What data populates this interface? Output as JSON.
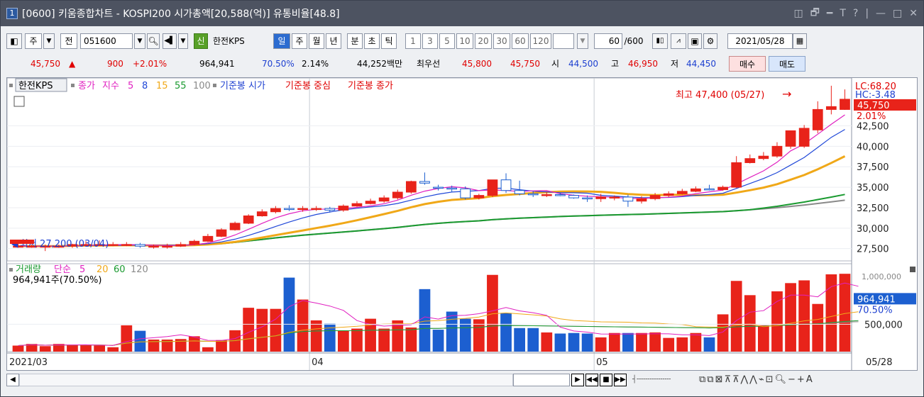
{
  "window": {
    "number": "1",
    "title": "[0600] 키움종합차트 - KOSPI200 시가총액[20,588(억)] 유통비율[48.8]",
    "buttons": [
      "◫",
      "🗗",
      "━",
      "T",
      "?",
      "|",
      "—",
      "□",
      "✕"
    ]
  },
  "toolbar": {
    "type": "주",
    "prefix": "전",
    "code": "051600",
    "name": "한전KPS",
    "new_badge": "신",
    "periods": [
      "일",
      "주",
      "월",
      "년",
      "분",
      "초",
      "틱"
    ],
    "intervals": [
      "1",
      "3",
      "5",
      "10",
      "20",
      "30",
      "60",
      "120"
    ],
    "count": "60",
    "count_max": "/600",
    "date": "2021/05/28"
  },
  "quote": {
    "price": "45,750",
    "arrow": "▲",
    "change": "900",
    "change_pct": "+2.01%",
    "volume": "964,941",
    "vol_ratio": "70.50%",
    "turnover": "2.14%",
    "amount": "44,252백만",
    "best_label": "최우선",
    "ask": "45,800",
    "bid": "45,750",
    "open_label": "시",
    "open": "44,500",
    "high_label": "고",
    "high": "46,950",
    "low_label": "저",
    "low": "44,450",
    "buy": "매수",
    "sell": "매도"
  },
  "price_legend": {
    "name": "한전KPS",
    "close": "종가",
    "ma_label": "지수",
    "periods": [
      "5",
      "8",
      "15",
      "55",
      "100"
    ],
    "open_ref": "기준봉 시가",
    "mid_ref": "기준봉 중심",
    "close_ref": "기준봉 종가"
  },
  "annotations": {
    "high": "최고 47,400 (05/27)",
    "low": "최저 27,200 (03/04)",
    "lc": "LC:68.20",
    "hc": "HC:-3.48",
    "last_price": "45,750",
    "last_pct": "2.01%"
  },
  "price_axis": [
    "42,500",
    "40,000",
    "37,500",
    "35,000",
    "32,500",
    "30,000",
    "27,500"
  ],
  "volume_legend": {
    "name": "거래량",
    "simple": "단순",
    "periods": [
      "5",
      "20",
      "60",
      "120"
    ],
    "current": "964,941주(70.50%)"
  },
  "volume_axis": {
    "tick": "500,000",
    "last": "964,941",
    "last_pct": "70.50%",
    "top_partial": "1,000,000"
  },
  "dates": {
    "start": "2021/03",
    "apr": "04",
    "may": "05",
    "end": "05/28"
  },
  "colors": {
    "up": "#e8231a",
    "down": "#1c5fd0",
    "ma5": "#e020c0",
    "ma8": "#2048d8",
    "ma15": "#f0a818",
    "ma55": "#1a9a30",
    "ma100": "#8a8a8a"
  },
  "chart_data": {
    "type": "candlestick",
    "title": "한전KPS",
    "dates": [
      "03/02",
      "03/03",
      "03/04",
      "03/05",
      "03/08",
      "03/09",
      "03/10",
      "03/11",
      "03/12",
      "03/15",
      "03/16",
      "03/17",
      "03/18",
      "03/19",
      "03/22",
      "03/23",
      "03/24",
      "03/25",
      "03/26",
      "03/29",
      "03/30",
      "03/31",
      "04/01",
      "04/02",
      "04/05",
      "04/06",
      "04/07",
      "04/08",
      "04/09",
      "04/12",
      "04/13",
      "04/14",
      "04/15",
      "04/16",
      "04/19",
      "04/20",
      "04/21",
      "04/22",
      "04/23",
      "04/26",
      "04/27",
      "04/28",
      "04/29",
      "04/30",
      "05/03",
      "05/04",
      "05/06",
      "05/07",
      "05/10",
      "05/11",
      "05/12",
      "05/13",
      "05/14",
      "05/17",
      "05/18",
      "05/20",
      "05/21",
      "05/24",
      "05/25",
      "05/26",
      "05/27",
      "05/28"
    ],
    "open": [
      27800,
      27800,
      27800,
      27800,
      27800,
      28000,
      28000,
      28000,
      28000,
      28000,
      27800,
      27800,
      27800,
      28000,
      28400,
      29000,
      29800,
      30600,
      31500,
      32000,
      32400,
      32300,
      32400,
      32400,
      32200,
      32700,
      33000,
      33300,
      33700,
      34400,
      35700,
      35000,
      34900,
      34800,
      33700,
      34000,
      35900,
      34600,
      34200,
      34100,
      34100,
      34000,
      33700,
      33600,
      33800,
      33800,
      33300,
      33600,
      34000,
      34200,
      34500,
      34800,
      34700,
      35000,
      38000,
      38500,
      38800,
      40000,
      40000,
      42000,
      44500,
      44500
    ],
    "high": [
      28100,
      28000,
      28000,
      28000,
      28100,
      28400,
      28500,
      28300,
      28300,
      28200,
      28000,
      28100,
      28300,
      28600,
      29300,
      30000,
      30800,
      31700,
      32300,
      32700,
      32800,
      32700,
      32700,
      32600,
      32900,
      33300,
      33600,
      34000,
      34700,
      35800,
      36800,
      35300,
      35200,
      35100,
      34200,
      35000,
      36700,
      35800,
      34500,
      34400,
      34300,
      34100,
      34000,
      34200,
      34000,
      34100,
      33900,
      34300,
      34500,
      34800,
      35100,
      35300,
      35200,
      38800,
      39000,
      39300,
      40500,
      41700,
      42600,
      45500,
      47400,
      46950
    ],
    "low": [
      27600,
      27600,
      27200,
      27600,
      27600,
      27900,
      27900,
      27800,
      27800,
      27600,
      27500,
      27500,
      27700,
      27900,
      28300,
      28900,
      29700,
      30500,
      31400,
      31800,
      32100,
      32000,
      32100,
      31900,
      32000,
      32600,
      32900,
      33100,
      33500,
      34200,
      35300,
      34600,
      34400,
      33500,
      33500,
      33800,
      34300,
      34000,
      33800,
      33800,
      33900,
      33600,
      33200,
      33200,
      33400,
      32600,
      33000,
      33400,
      33800,
      34100,
      34400,
      34600,
      34600,
      34900,
      37900,
      38300,
      38600,
      39700,
      39800,
      41600,
      43900,
      44450
    ],
    "close": [
      27800,
      27800,
      27800,
      27800,
      28000,
      28000,
      28000,
      28000,
      28000,
      27800,
      27800,
      27800,
      28000,
      28400,
      29000,
      29800,
      30600,
      31500,
      32000,
      32400,
      32300,
      32400,
      32400,
      32200,
      32700,
      33000,
      33300,
      33700,
      34400,
      35700,
      35500,
      34900,
      34800,
      33700,
      34000,
      35900,
      34600,
      34200,
      34100,
      34100,
      34000,
      33700,
      33600,
      33800,
      33800,
      33300,
      33600,
      34000,
      34200,
      34500,
      34800,
      34700,
      35000,
      38000,
      38500,
      38800,
      40000,
      41900,
      42200,
      44500,
      44850,
      45750
    ],
    "volume": [
      110000,
      140000,
      100000,
      140000,
      120000,
      120000,
      110000,
      80000,
      480000,
      380000,
      220000,
      220000,
      230000,
      280000,
      80000,
      210000,
      390000,
      800000,
      780000,
      780000,
      1350000,
      950000,
      570000,
      510000,
      380000,
      420000,
      600000,
      420000,
      570000,
      440000,
      1140000,
      400000,
      730000,
      600000,
      590000,
      1400000,
      700000,
      430000,
      430000,
      350000,
      330000,
      340000,
      330000,
      260000,
      340000,
      340000,
      340000,
      350000,
      250000,
      260000,
      340000,
      260000,
      680000,
      1290000,
      1030000,
      480000,
      1100000,
      1250000,
      1300000,
      870000,
      1410000,
      1420000,
      960000
    ],
    "ylim": [
      26000,
      48000
    ]
  }
}
